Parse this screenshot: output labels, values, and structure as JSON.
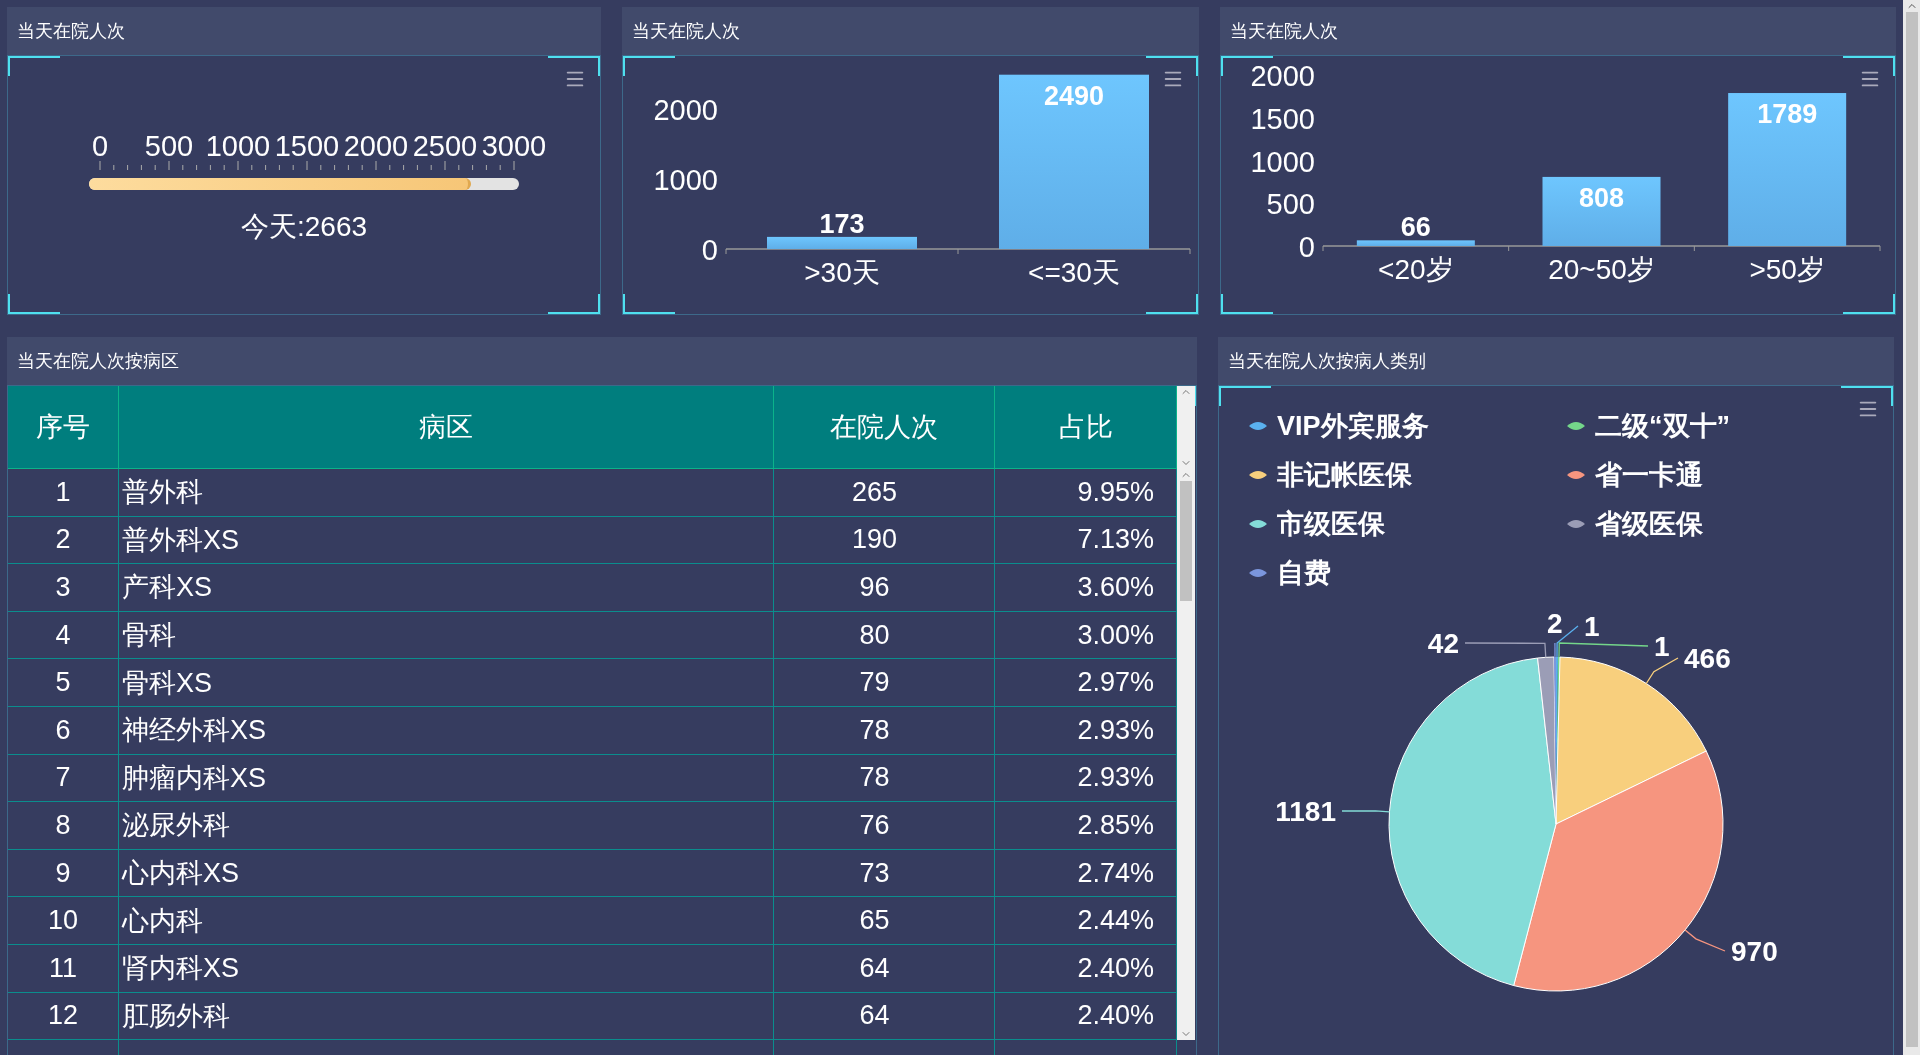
{
  "gauge_panel": {
    "title": "当天在院人次",
    "ticks": [
      "0",
      "500",
      "1000",
      "1500",
      "2000",
      "2500",
      "3000"
    ],
    "level": 0.8877,
    "caption": "今天:2663"
  },
  "stay_panel": {
    "title": "当天在院人次",
    "chart_data": {
      "type": "bar",
      "categories": [
        ">30天",
        "<=30天"
      ],
      "values": [
        173,
        2490
      ],
      "ylim": [
        0,
        2500
      ],
      "yticks": [
        0,
        1000,
        2000
      ],
      "data_labels": true
    }
  },
  "age_panel": {
    "title": "当天在院人次",
    "chart_data": {
      "type": "bar",
      "categories": [
        "<20岁",
        "20~50岁",
        ">50岁"
      ],
      "values": [
        66,
        808,
        1789
      ],
      "ylim": [
        0,
        2000
      ],
      "yticks": [
        0,
        500,
        1000,
        1500,
        2000
      ],
      "data_labels": true
    }
  },
  "ward_panel": {
    "title": "当天在院人次按病区",
    "table": {
      "columns": [
        "序号",
        "病区",
        "在院人次",
        "占比"
      ],
      "rows": [
        [
          "1",
          "普外科",
          "265",
          "9.95%"
        ],
        [
          "2",
          "普外科XS",
          "190",
          "7.13%"
        ],
        [
          "3",
          "产科XS",
          "96",
          "3.60%"
        ],
        [
          "4",
          "骨科",
          "80",
          "3.00%"
        ],
        [
          "5",
          "骨科XS",
          "79",
          "2.97%"
        ],
        [
          "6",
          "神经外科XS",
          "78",
          "2.93%"
        ],
        [
          "7",
          "肿瘤内科XS",
          "78",
          "2.93%"
        ],
        [
          "8",
          "泌尿外科",
          "76",
          "2.85%"
        ],
        [
          "9",
          "心内科XS",
          "73",
          "2.74%"
        ],
        [
          "10",
          "心内科",
          "65",
          "2.44%"
        ],
        [
          "11",
          "肾内科XS",
          "64",
          "2.40%"
        ],
        [
          "12",
          "肛肠外科",
          "64",
          "2.40%"
        ]
      ]
    }
  },
  "category_panel": {
    "title": "当天在院人次按病人类别",
    "chart_data": {
      "type": "pie",
      "categories": [
        "VIP外宾服务",
        "二级“双十”",
        "非记帐医保",
        "省一卡通",
        "市级医保",
        "省级医保",
        "自费"
      ],
      "values": [
        1,
        1,
        466,
        970,
        1181,
        42,
        2
      ],
      "colors": [
        "#5ab1ef",
        "#74d68a",
        "#f8cf7d",
        "#f6957f",
        "#84dcd8",
        "#9b9db6",
        "#7b96dd"
      ],
      "data_labels": true
    }
  }
}
